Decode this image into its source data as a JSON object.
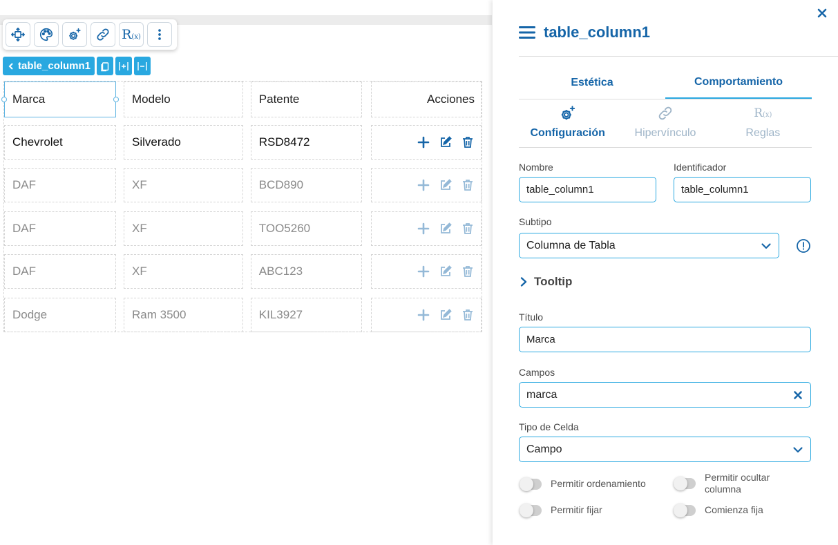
{
  "selection": {
    "component_name": "table_column1"
  },
  "table": {
    "headers": [
      "Marca",
      "Modelo",
      "Patente",
      "Acciones"
    ],
    "rows": [
      [
        "Chevrolet",
        "Silverado",
        "RSD8472"
      ],
      [
        "DAF",
        "XF",
        "BCD890"
      ],
      [
        "DAF",
        "XF",
        "TOO5260"
      ],
      [
        "DAF",
        "XF",
        "ABC123"
      ],
      [
        "Dodge",
        "Ram 3500",
        "KIL3927"
      ]
    ]
  },
  "toolbar": {
    "rules_glyph": "R",
    "rules_sub": "(x)"
  },
  "panel": {
    "title": "table_column1",
    "tabs": {
      "aesthetics": "Estética",
      "behavior": "Comportamiento"
    },
    "subtabs": {
      "config": "Configuración",
      "hyperlink": "Hipervínculo",
      "rules": "Reglas"
    },
    "fields": {
      "name_label": "Nombre",
      "name_value": "table_column1",
      "id_label": "Identificador",
      "id_value": "table_column1",
      "subtype_label": "Subtipo",
      "subtype_value": "Columna de Tabla",
      "tooltip_label": "Tooltip",
      "title_label": "Título",
      "title_value": "Marca",
      "fields_label": "Campos",
      "fields_value": "marca",
      "cell_type_label": "Tipo de Celda",
      "cell_type_value": "Campo"
    },
    "toggles": {
      "allow_sort": "Permitir ordenamiento",
      "allow_hide_line1": "Permitir ocultar",
      "allow_hide_line2": "columna",
      "allow_pin": "Permitir fijar",
      "starts_pinned": "Comienza fija"
    }
  },
  "colors": {
    "accent": "#29a8e0",
    "primary": "#1565a8",
    "muted": "#9fb5c8"
  }
}
